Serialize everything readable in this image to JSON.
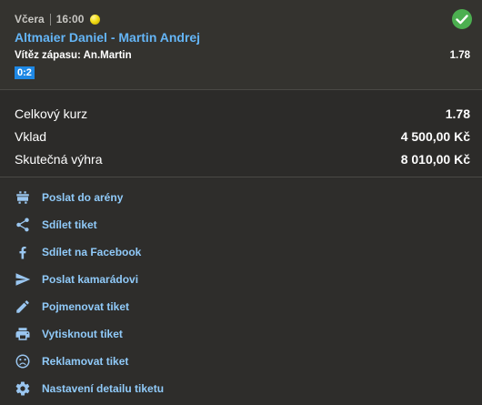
{
  "bet": {
    "day": "Včera",
    "time": "16:00",
    "sport_icon": "tennis-ball-icon",
    "status_icon": "check-circle-icon",
    "status_color": "#4caf50",
    "match": "Altmaier Daniel - Martin Andrej",
    "market": "Vítěz zápasu: An.Martin",
    "odds": "1.78",
    "score": "0:2"
  },
  "summary": {
    "total_odds_label": "Celkový kurz",
    "total_odds_value": "1.78",
    "stake_label": "Vklad",
    "stake_value": "4 500,00 Kč",
    "win_label": "Skutečná výhra",
    "win_value": "8 010,00 Kč"
  },
  "actions": [
    {
      "label": "Poslat do arény",
      "icon": "arena-icon"
    },
    {
      "label": "Sdílet tiket",
      "icon": "share-icon"
    },
    {
      "label": "Sdílet na Facebook",
      "icon": "facebook-icon"
    },
    {
      "label": "Poslat kamarádovi",
      "icon": "send-icon"
    },
    {
      "label": "Pojmenovat tiket",
      "icon": "pencil-icon"
    },
    {
      "label": "Vytisknout tiket",
      "icon": "printer-icon"
    },
    {
      "label": "Reklamovat tiket",
      "icon": "sad-face-icon"
    },
    {
      "label": "Nastavení detailu tiketu",
      "icon": "gear-icon"
    }
  ],
  "colors": {
    "link": "#90caf9",
    "match_name": "#64b5f6",
    "score_badge": "#1e88e5",
    "background": "#2e2d2b"
  }
}
